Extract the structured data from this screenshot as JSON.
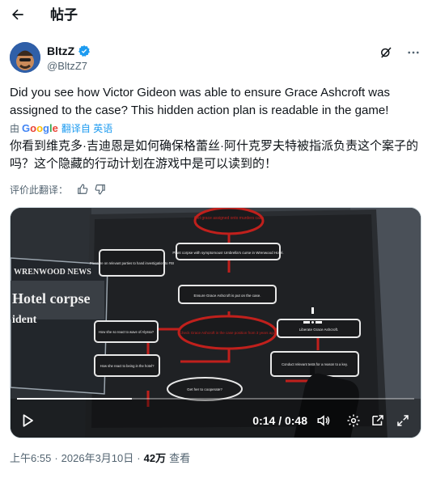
{
  "header": {
    "title": "帖子"
  },
  "author": {
    "display_name": "BltzZ",
    "handle": "@BltzZ7"
  },
  "post": {
    "text": "Did you see how Victor Gideon was able to ensure Grace Ashcroft was assigned to the case? This hidden action plan is readable in the game!",
    "translate_prefix": "由",
    "translate_brand": "Google",
    "translate_link": "翻译自 英语",
    "translated_text": "你看到维克多·吉迪恩是如何确保格蕾丝·阿什克罗夫特被指派负责这个案子的吗？这个隐藏的行动计划在游戏中是可以读到的！",
    "rate_label": "评价此翻译："
  },
  "video": {
    "time": "0:14 / 0:48",
    "progress": 0.29,
    "newspaper": {
      "masthead": "WRENWOOD NEWS",
      "headline": "Hotel corpse",
      "subhead": "ident"
    },
    "flowchart": {
      "top": "Get grace assigned onto murders case",
      "plant": "Plant corpse with symptomous! Umbrella's curse in Wrenwood Hotel.",
      "left1": "Pressure on relevant parties to hand investigation to FBI",
      "ensure": "Ensure Grace Ashcroft is put on the case.",
      "check": "Check Grace Ashcroft in the case position from 3 years ago",
      "liberate": "Liberate Grace Ashcroft.",
      "left2": "How she so react to wave of Alyssa?",
      "left3": "How she react to being in the hotel?",
      "conduct": "Conduct relevant tests for a reason to a key.",
      "gether": "Get her to cooperate?"
    }
  },
  "meta": {
    "time": "上午6:55",
    "dot1": "·",
    "date": "2026年3月10日",
    "dot2": "·",
    "views": "42万",
    "views_label": "查看"
  },
  "colors": {
    "accent": "#1d9bf0",
    "verified": "#1d9bf0",
    "red": "#c0201c"
  }
}
